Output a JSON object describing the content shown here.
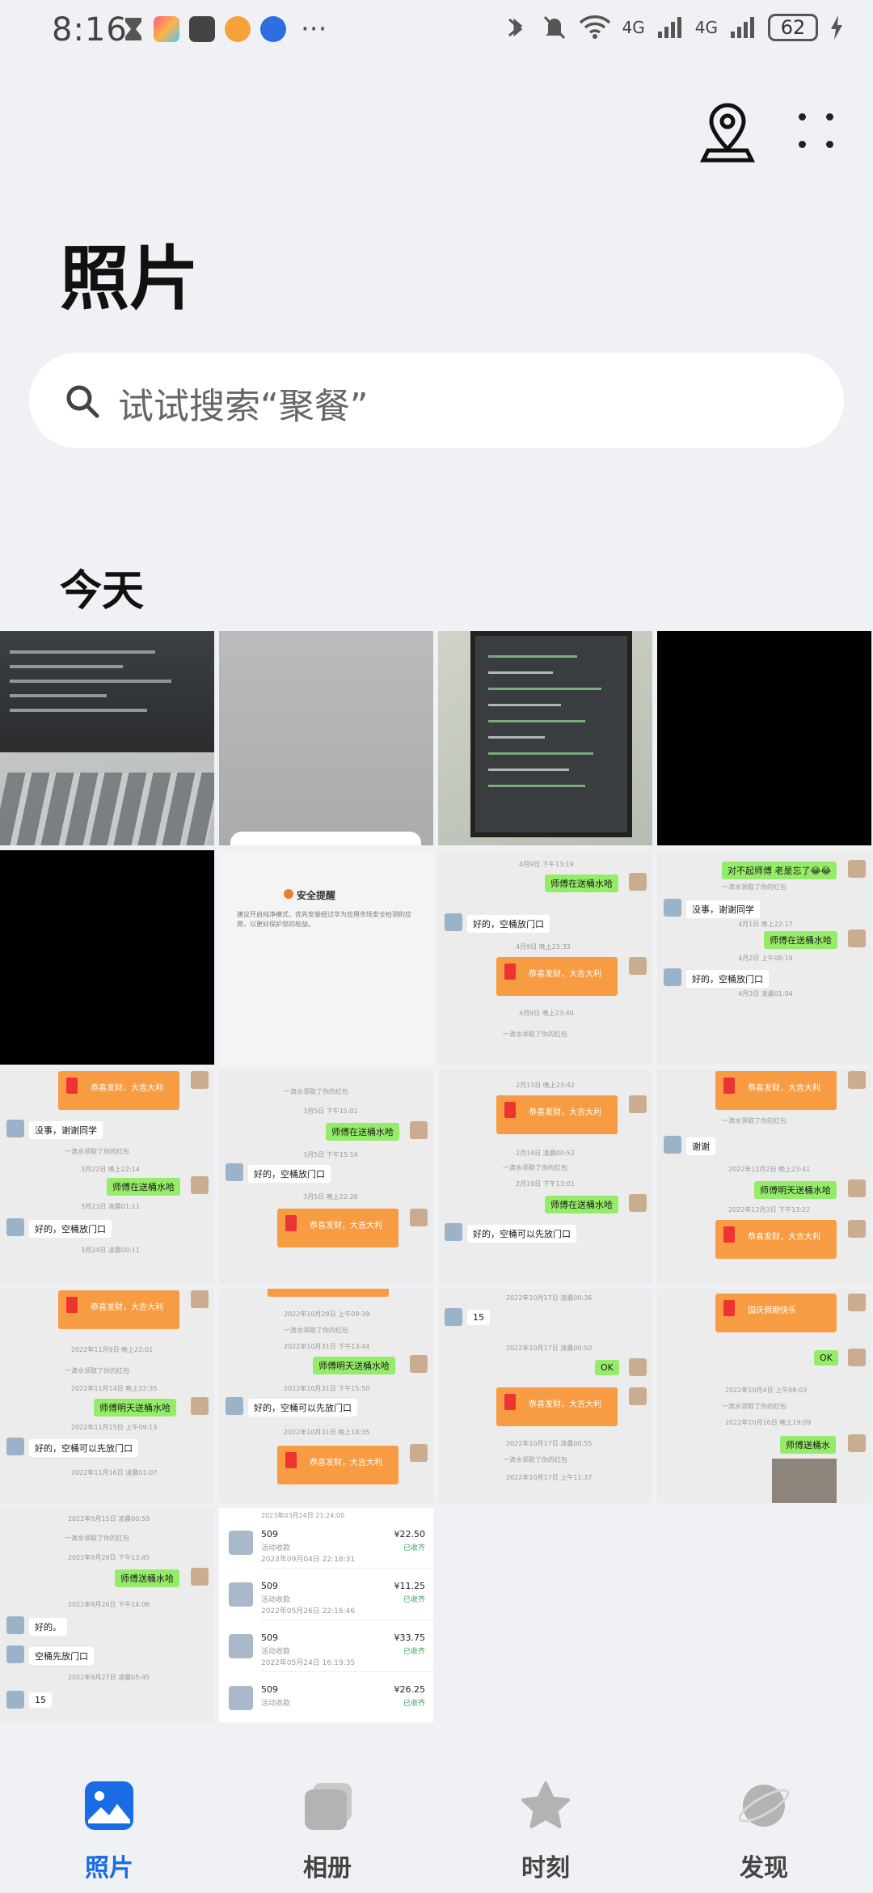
{
  "status_bar": {
    "time": "8:16",
    "network_1": "4G",
    "network_2": "4G",
    "battery": "62",
    "more": "···"
  },
  "header": {
    "title": "照片",
    "search_placeholder": "试试搜索“聚餐”"
  },
  "section": {
    "label": "今天"
  },
  "tiles": {
    "alert_title": "安全提醒",
    "alert_body": "建议开启纯净模式，优先安装经过华为应用市场安全检测的应用，以更好保护您的权益。",
    "chat": {
      "t7_ts1": "4月9日 下午13:19",
      "t7_b1": "师傅在送桶水哈",
      "t7_b2": "好的，空桶放门口",
      "t7_ts2": "4月9日 晚上23:33",
      "t7_env": "恭喜发财，大吉大利",
      "t7_ts3": "4月9日 晚上23:40",
      "t7_note": "一滴水领取了你的红包",
      "t8_b1": "对不起师傅 老是忘了😂😂",
      "t8_note": "一滴水领取了你的红包",
      "t8_b2": "没事，谢谢同学",
      "t8_ts1": "4月1日 晚上22:17",
      "t8_b3": "师傅在送桶水哈",
      "t8_ts2": "4月2日 上午08:19",
      "t8_b4": "好的，空桶放门口",
      "t8_ts3": "4月3日 凌晨01:04",
      "t9_env": "恭喜发财，大吉大利",
      "t9_b1": "没事，谢谢同学",
      "t9_note": "一滴水领取了你的红包",
      "t9_ts1": "3月22日 晚上22:14",
      "t9_b2": "师傅在送桶水哈",
      "t9_ts2": "3月23日 凌晨01:11",
      "t9_b3": "好的，空桶放门口",
      "t9_ts3": "3月24日 凌晨00:11",
      "t10_note": "一滴水领取了你的红包",
      "t10_ts1": "3月5日 下午15:01",
      "t10_b1": "师傅在送桶水哈",
      "t10_ts2": "3月5日 下午15:14",
      "t10_b2": "好的，空桶放门口",
      "t10_ts3": "3月5日 晚上22:20",
      "t10_env": "恭喜发财，大吉大利",
      "t11_ts1": "2月13日 晚上23:42",
      "t11_env": "恭喜发财，大吉大利",
      "t11_ts2": "2月14日 凌晨00:52",
      "t11_note": "一滴水领取了你的红包",
      "t11_ts3": "2月19日 下午13:01",
      "t11_b1": "师傅在送桶水哈",
      "t11_b2": "好的，空桶可以先放门口",
      "t12_env": "恭喜发财，大吉大利",
      "t12_note": "一滴水领取了你的红包",
      "t12_b1": "谢谢",
      "t12_ts1": "2022年12月2日 晚上23:41",
      "t12_b2": "师傅明天送桶水哈",
      "t12_ts2": "2022年12月3日 下午13:22",
      "t12_env2": "恭喜发财，大吉大利",
      "t13_env": "恭喜发财，大吉大利",
      "t13_ts1": "2022年11月9日 晚上22:01",
      "t13_note": "一滴水领取了你的红包",
      "t13_ts2": "2022年11月14日 晚上22:35",
      "t13_b1": "师傅明天送桶水哈",
      "t13_ts3": "2022年11月15日 上午09:13",
      "t13_b2": "好的，空桶可以先放门口",
      "t13_ts4": "2022年11月16日 凌晨01:07",
      "t14_ts1": "2022年10月28日 上午09:39",
      "t14_note": "一滴水领取了你的红包",
      "t14_ts2": "2022年10月31日 下午13:44",
      "t14_b1": "师傅明天送桶水哈",
      "t14_ts3": "2022年10月31日 下午15:50",
      "t14_b2": "好的，空桶可以先放门口",
      "t14_ts4": "2022年10月31日 晚上18:35",
      "t14_env": "恭喜发财，大吉大利",
      "t15_ts1": "2022年10月17日 凌晨00:36",
      "t15_b1": "15",
      "t15_ts2": "2022年10月17日 凌晨00:50",
      "t15_b2": "OK",
      "t15_env": "恭喜发财，大吉大利",
      "t15_ts3": "2022年10月17日 凌晨00:55",
      "t15_note": "一滴水领取了你的红包",
      "t15_ts4": "2022年10月17日 上午11:37",
      "t16_env": "国庆假期快乐",
      "t16_b1": "OK",
      "t16_ts1": "2022年10月4日 上午08:03",
      "t16_note": "一滴水领取了你的红包",
      "t16_ts2": "2022年10月16日 晚上19:09",
      "t16_b2": "师傅送桶水",
      "t17_ts1": "2022年9月15日 凌晨00:59",
      "t17_note": "一滴水领取了你的红包",
      "t17_ts2": "2022年9月26日 下午13:45",
      "t17_b1": "师傅送桶水哈",
      "t17_ts3": "2022年9月26日 下午14:06",
      "t17_b2": "好的。",
      "t17_b3": "空桶先放门口",
      "t17_ts4": "2022年9月27日 凌晨05:45",
      "t17_b4": "15"
    },
    "payments": [
      {
        "name": "509",
        "sub": "活动收款",
        "date": "2023年09月04日 22:18:31",
        "amount": "¥22.50",
        "status": "已收齐"
      },
      {
        "name": "509",
        "sub": "活动收款",
        "date": "2022年05月26日 22:16:46",
        "amount": "¥11.25",
        "status": "已收齐"
      },
      {
        "name": "509",
        "sub": "活动收款",
        "date": "2022年05月24日 16:19:35",
        "amount": "¥33.75",
        "status": "已收齐"
      },
      {
        "name": "509",
        "sub": "活动收款",
        "date": "",
        "amount": "¥26.25",
        "status": "已收齐"
      }
    ],
    "payments_top_ts": "2023年03月24日 21:24:00"
  },
  "bottom_nav": [
    {
      "label": "照片",
      "icon": "photos-icon",
      "active": true
    },
    {
      "label": "相册",
      "icon": "albums-icon",
      "active": false
    },
    {
      "label": "时刻",
      "icon": "moments-star-icon",
      "active": false
    },
    {
      "label": "发现",
      "icon": "discover-planet-icon",
      "active": false
    }
  ],
  "colors": {
    "accent": "#1a6ce5",
    "background": "#eff1f5",
    "chat_green": "#95ec69",
    "red_packet": "#f79c42"
  }
}
